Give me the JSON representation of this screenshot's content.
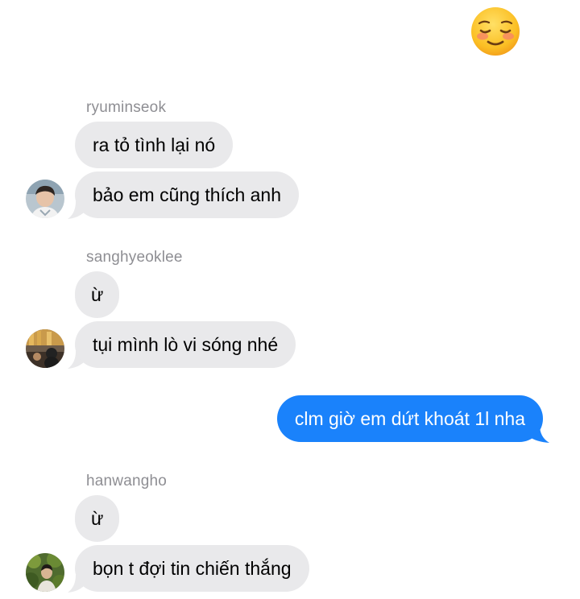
{
  "reaction_emoji": {
    "icon": "smiling-face-with-blush-emoji"
  },
  "thread": {
    "groups": [
      {
        "sender": "ryuminseok",
        "messages": [
          "ra tỏ tình lại nó",
          "bảo em cũng thích anh"
        ],
        "avatar_icon": "avatar-ryuminseok"
      },
      {
        "sender": "sanghyeoklee",
        "messages": [
          "ừ",
          "tụi mình lò vi sóng nhé"
        ],
        "avatar_icon": "avatar-sanghyeoklee"
      },
      {
        "outgoing": {
          "text": "clm giờ em dứt khoát 1l nha"
        }
      },
      {
        "sender": "hanwangho",
        "messages": [
          "ừ",
          "bọn t đợi tin chiến thắng"
        ],
        "avatar_icon": "avatar-hanwangho"
      }
    ]
  },
  "colors": {
    "incoming_bubble": "#e9e9eb",
    "outgoing_bubble": "#1a82fb",
    "sender_name": "#8e8e93"
  }
}
